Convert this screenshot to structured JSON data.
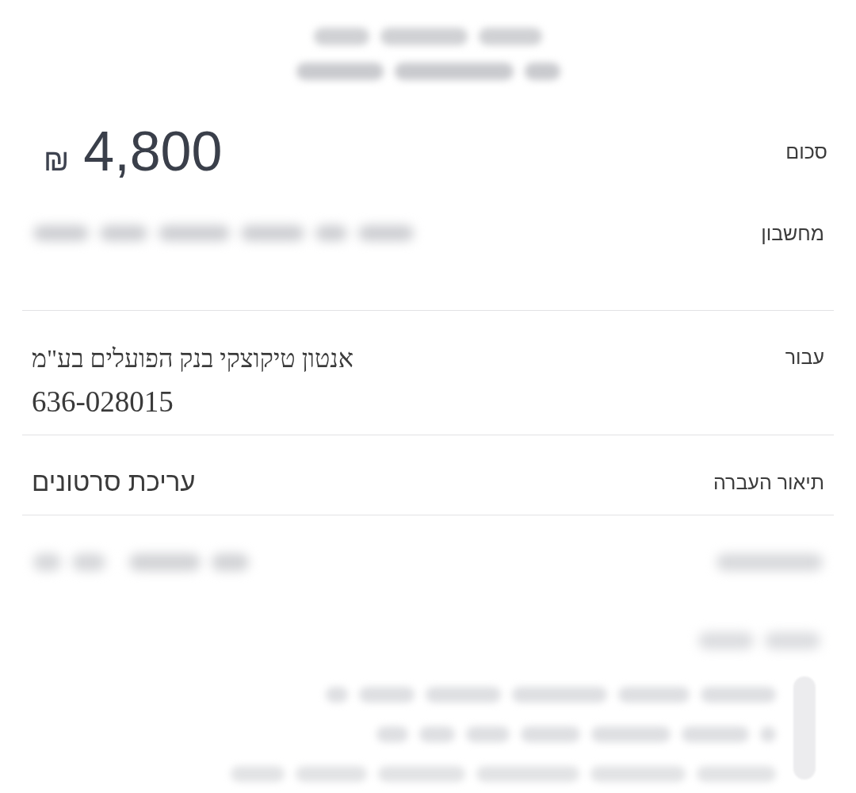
{
  "rows": [
    {
      "kind": "redacted_header"
    },
    {
      "kind": "amount",
      "label": "סכום",
      "value": "4,800",
      "currency": "₪"
    },
    {
      "kind": "redacted_value",
      "label": "מחשבון"
    },
    {
      "kind": "serif_text",
      "label": "עבור",
      "lines": [
        "אנטון טיקוצקי בנק הפועלים בע\"מ",
        "636-028015"
      ]
    },
    {
      "kind": "sans_text",
      "label": "תיאור העברה",
      "lines": [
        "עריכת סרטונים"
      ]
    },
    {
      "kind": "redacted_row"
    },
    {
      "kind": "redacted_note"
    }
  ]
}
